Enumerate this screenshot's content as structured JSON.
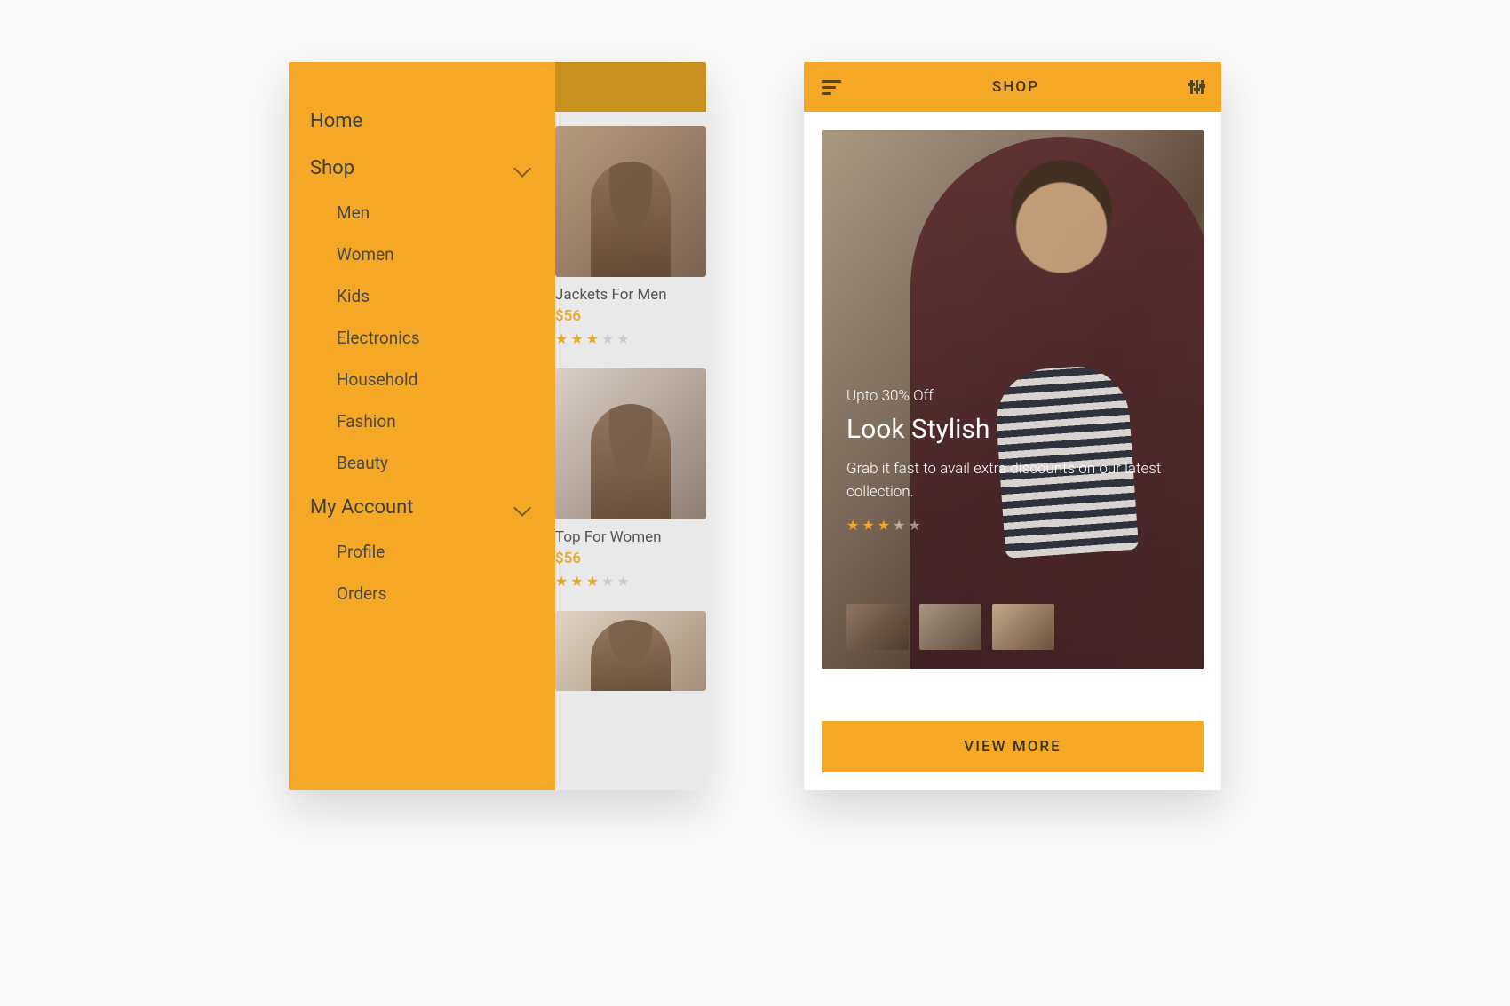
{
  "screen1": {
    "drawer": {
      "home": "Home",
      "shop": "Shop",
      "shop_sub": [
        "Men",
        "Women",
        "Kids",
        "Electronics",
        "Household",
        "Fashion",
        "Beauty"
      ],
      "account": "My Account",
      "account_sub": [
        "Profile",
        "Orders"
      ]
    },
    "products": [
      {
        "title": "Jackets For Men",
        "price": "$56",
        "rating": 3
      },
      {
        "title": "Top For Women",
        "price": "$56",
        "rating": 3
      }
    ]
  },
  "screen2": {
    "header_title": "SHOP",
    "hero": {
      "tag": "Upto 30% Off",
      "headline": "Look Stylish",
      "desc": "Grab it fast to avail extra discounts on our latest collection.",
      "rating": 3
    },
    "cta": "VIEW MORE"
  }
}
